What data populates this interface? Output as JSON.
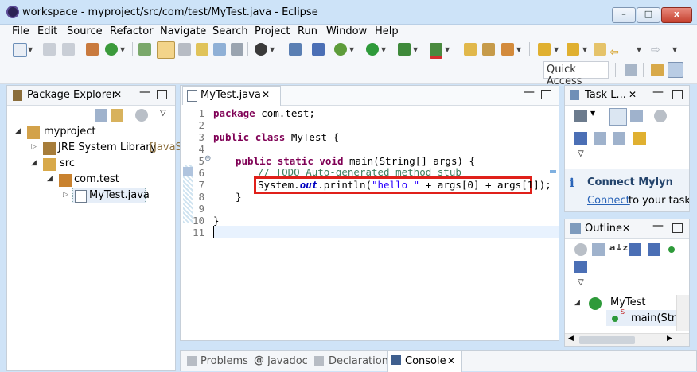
{
  "window": {
    "title": "workspace - myproject/src/com/test/MyTest.java - Eclipse",
    "minimize": "–",
    "maximize": "□",
    "close": "x"
  },
  "menu": [
    "File",
    "Edit",
    "Source",
    "Refactor",
    "Navigate",
    "Search",
    "Project",
    "Run",
    "Window",
    "Help"
  ],
  "toolbar": {
    "quick_access": "Quick Access"
  },
  "package_explorer": {
    "tab": "Package Explorer",
    "tree": {
      "project": "myproject",
      "jre": "JRE System Library",
      "jre_suffix": "[JavaS",
      "src": "src",
      "package": "com.test",
      "file": "MyTest.java"
    }
  },
  "editor": {
    "tab": "MyTest.java",
    "line_numbers": [
      "1",
      "2",
      "3",
      "4",
      "5",
      "6",
      "7",
      "8",
      "9",
      "10",
      "11"
    ],
    "lines": {
      "l1_kw": "package",
      "l1_rest": " com.test;",
      "l3_kw1": "public",
      "l3_kw2": "class",
      "l3_rest": " MyTest {",
      "l5_kw1": "public",
      "l5_kw2": "static",
      "l5_kw3": "void",
      "l5_rest": " main(String[] args) {",
      "l6_comment": "// TODO Auto-generated method stub",
      "l7_a": "System.",
      "l7_field": "out",
      "l7_b": ".println(",
      "l7_str": "\"hello \"",
      "l7_c": " + args[0] + args[1]);",
      "l8": "}",
      "l10": "}"
    },
    "fold_marker": "⊖",
    "highlight_color": "#e0201a"
  },
  "task_list": {
    "tab": "Task L...",
    "mylyn_title": "Connect Mylyn",
    "mylyn_link": "Connect",
    "mylyn_text": " to your task a"
  },
  "outline": {
    "tab": "Outline",
    "class_name": "MyTest",
    "method": "main(Strin",
    "static_marker": "S"
  },
  "bottom_tabs": [
    "Problems",
    "Javadoc",
    "Declaration",
    "Console"
  ],
  "colors": {
    "accent": "#2a64b8",
    "keyword": "#7f0055",
    "string": "#2a00ff",
    "comment": "#3f7f5f"
  }
}
